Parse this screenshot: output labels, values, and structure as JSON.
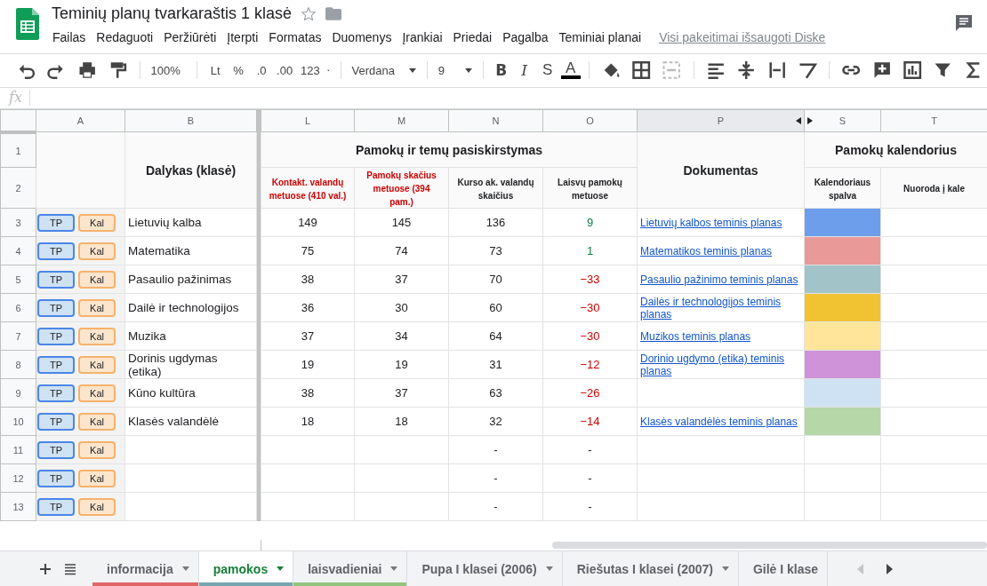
{
  "document": {
    "title": "Teminių planų tvarkaraštis 1 klasė"
  },
  "menu": [
    "Failas",
    "Redaguoti",
    "Peržiūrėti",
    "Įterpti",
    "Formatas",
    "Duomenys",
    "Įrankiai",
    "Priedai",
    "Pagalba",
    "Teminiai planai"
  ],
  "save_status": "Visi pakeitimai išsaugoti Diske",
  "toolbar": {
    "zoom": "100%",
    "currency": "Lt",
    "percent": "%",
    "decrease_decimals": ".0",
    "increase_decimals": ".00",
    "number_format": "123",
    "font": "Verdana",
    "font_size": "9",
    "bold": "B",
    "italic": "I",
    "strikethrough": "S",
    "text_color": "A"
  },
  "formula_bar": {
    "label": "fx"
  },
  "columns": [
    {
      "letter": "A",
      "highlighted": false
    },
    {
      "letter": "B",
      "highlighted": false
    },
    {
      "letter": "L",
      "highlighted": false
    },
    {
      "letter": "M",
      "highlighted": false
    },
    {
      "letter": "N",
      "highlighted": false
    },
    {
      "letter": "O",
      "highlighted": false
    },
    {
      "letter": "P",
      "highlighted": true,
      "hidden_after": true
    },
    {
      "letter": "S",
      "highlighted": false
    },
    {
      "letter": "T",
      "highlighted": false
    }
  ],
  "header": {
    "row_numbers": [
      "1",
      "2"
    ],
    "subject": "Dalykas (klasė)",
    "distribution": "Pamokų ir temų pasiskirstymas",
    "subheaders": [
      {
        "text": "Kontakt. valandų metuose (410 val.)",
        "highlighted": true
      },
      {
        "text": "Pamokų skačius metuose (394 pam.)",
        "highlighted": true
      },
      {
        "text": "Kurso ak. valandų skaičius",
        "highlighted": false
      },
      {
        "text": "Laisvų pamokų metuose",
        "highlighted": false
      }
    ],
    "document": "Dokumentas",
    "calendar": "Pamokų kalendorius",
    "calendar_color": "Kalendoriaus spalva",
    "calendar_link": "Nuoroda į kale"
  },
  "rows": [
    {
      "number": "3",
      "plan_button": "TP",
      "calendar_button": "Kal",
      "subject": "Lietuvių kalba",
      "contact_hours": "149",
      "lessons": "145",
      "course_hours": "136",
      "free_lessons": "9",
      "positive": true,
      "negative": false,
      "document": "Lietuvių kalbos teminis planas",
      "color": "#6d9eeb"
    },
    {
      "number": "4",
      "plan_button": "TP",
      "calendar_button": "Kal",
      "subject": "Matematika",
      "contact_hours": "75",
      "lessons": "74",
      "course_hours": "73",
      "free_lessons": "1",
      "positive": true,
      "negative": false,
      "document": "Matematikos teminis planas",
      "color": "#ea9999"
    },
    {
      "number": "5",
      "plan_button": "TP",
      "calendar_button": "Kal",
      "subject": "Pasaulio pažinimas",
      "contact_hours": "38",
      "lessons": "37",
      "course_hours": "70",
      "free_lessons": "−33",
      "positive": false,
      "negative": true,
      "document": "Pasaulio pažinimo teminis planas",
      "color": "#a2c4c9"
    },
    {
      "number": "6",
      "plan_button": "TP",
      "calendar_button": "Kal",
      "subject": "Dailė ir technologijos",
      "contact_hours": "36",
      "lessons": "30",
      "course_hours": "60",
      "free_lessons": "−30",
      "positive": false,
      "negative": true,
      "document": "Dailės ir technologijos teminis planas",
      "color": "#f1c232"
    },
    {
      "number": "7",
      "plan_button": "TP",
      "calendar_button": "Kal",
      "subject": "Muzika",
      "contact_hours": "37",
      "lessons": "34",
      "course_hours": "64",
      "free_lessons": "−30",
      "positive": false,
      "negative": true,
      "document": "Muzikos teminis planas",
      "color": "#ffe599"
    },
    {
      "number": "8",
      "plan_button": "TP",
      "calendar_button": "Kal",
      "subject": "Dorinis ugdymas (etika)",
      "contact_hours": "19",
      "lessons": "19",
      "course_hours": "31",
      "free_lessons": "−12",
      "positive": false,
      "negative": true,
      "document": "Dorinio ugdymo (etika) teminis planas",
      "color": "#ce93d8"
    },
    {
      "number": "9",
      "plan_button": "TP",
      "calendar_button": "Kal",
      "subject": "Kūno kultūra",
      "contact_hours": "38",
      "lessons": "37",
      "course_hours": "63",
      "free_lessons": "−26",
      "positive": false,
      "negative": true,
      "color": "#cfe2f3"
    },
    {
      "number": "10",
      "plan_button": "TP",
      "calendar_button": "Kal",
      "subject": "Klasės valandėlė",
      "contact_hours": "18",
      "lessons": "18",
      "course_hours": "32",
      "free_lessons": "−14",
      "positive": false,
      "negative": true,
      "document": "Klasės valandėlės teminis planas",
      "color": "#b6d7a8"
    },
    {
      "number": "11",
      "plan_button": "TP",
      "calendar_button": "Kal",
      "course_hours": "-",
      "free_lessons": "-",
      "positive": false,
      "negative": false
    },
    {
      "number": "12",
      "plan_button": "TP",
      "calendar_button": "Kal",
      "course_hours": "-",
      "free_lessons": "-",
      "positive": false,
      "negative": false
    },
    {
      "number": "13",
      "plan_button": "TP",
      "calendar_button": "Kal",
      "course_hours": "-",
      "free_lessons": "-",
      "positive": false,
      "negative": false
    }
  ],
  "sheet_tabs": [
    {
      "label": "informacija",
      "selected": false,
      "color": "#e06666"
    },
    {
      "label": "pamokos",
      "selected": true,
      "color": "#76a5af"
    },
    {
      "label": "laisvadieniai",
      "selected": false,
      "color": "#93c47d"
    },
    {
      "label": "Pupa I klasei (2006)",
      "selected": false
    },
    {
      "label": "Riešutas I klasei (2007)",
      "selected": false
    },
    {
      "label": "Gilė I klase",
      "selected": false
    }
  ]
}
